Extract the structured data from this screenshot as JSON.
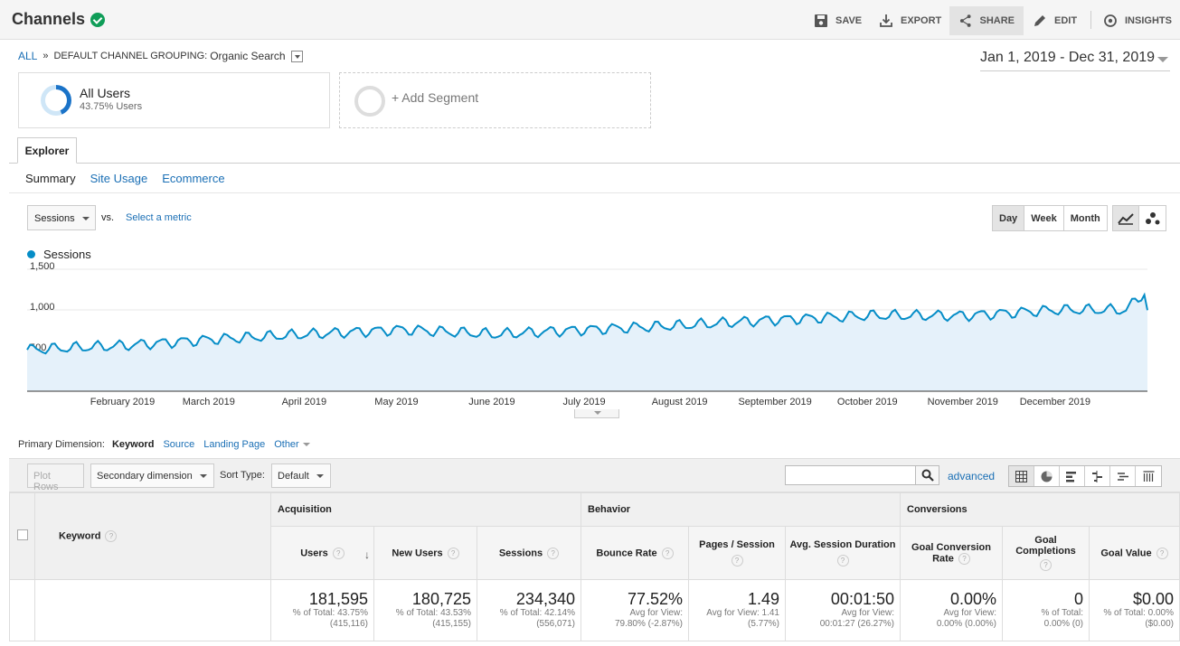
{
  "header": {
    "title": "Channels",
    "actions": [
      {
        "id": "save",
        "label": "SAVE",
        "icon": "save-icon"
      },
      {
        "id": "export",
        "label": "EXPORT",
        "icon": "export-icon"
      },
      {
        "id": "share",
        "label": "SHARE",
        "icon": "share-icon"
      },
      {
        "id": "edit",
        "label": "EDIT",
        "icon": "edit-icon"
      },
      {
        "id": "insights",
        "label": "INSIGHTS",
        "icon": "insights-icon"
      }
    ]
  },
  "breadcrumb": {
    "all": "ALL",
    "sep": "»",
    "grouping": "DEFAULT CHANNEL GROUPING:",
    "value": "Organic Search"
  },
  "date_range": "Jan 1, 2019 - Dec 31, 2019",
  "segments": {
    "primary_name": "All Users",
    "primary_sub": "43.75% Users",
    "add_label": "+ Add Segment"
  },
  "explorer": {
    "tab": "Explorer",
    "subtabs": [
      "Summary",
      "Site Usage",
      "Ecommerce"
    ]
  },
  "chart_controls": {
    "metric": "Sessions",
    "vs": "vs.",
    "select_metric": "Select a metric",
    "periods": [
      "Day",
      "Week",
      "Month"
    ],
    "selected_period": "Day"
  },
  "chart_data": {
    "type": "area",
    "legend": [
      "Sessions"
    ],
    "series": [
      {
        "name": "Sessions",
        "color": "#058dc7"
      }
    ],
    "y_ticks": [
      "1,500",
      "1,000",
      "500"
    ],
    "ylim": [
      0,
      1500
    ],
    "x_ticks": [
      "February 2019",
      "March 2019",
      "April 2019",
      "May 2019",
      "June 2019",
      "July 2019",
      "August 2019",
      "September 2019",
      "October 2019",
      "November 2019",
      "December 2019"
    ],
    "monthly_mean": [
      510,
      560,
      640,
      700,
      760,
      700,
      760,
      810,
      880,
      930,
      930,
      1000
    ],
    "weekly_amplitude": 55,
    "days": 365
  },
  "primary_dimension": {
    "label": "Primary Dimension:",
    "selected": "Keyword",
    "options": [
      "Source",
      "Landing Page"
    ],
    "other": "Other"
  },
  "table_toolbar": {
    "plot_rows": "Plot Rows",
    "secondary": "Secondary dimension",
    "sort_type_label": "Sort Type:",
    "sort_type": "Default",
    "search_value": "",
    "advanced": "advanced"
  },
  "table": {
    "keyword_header": "Keyword",
    "groups": [
      "Acquisition",
      "Behavior",
      "Conversions"
    ],
    "columns": [
      "Users",
      "New Users",
      "Sessions",
      "Bounce Rate",
      "Pages / Session",
      "Avg. Session Duration",
      "Goal Conversion Rate",
      "Goal Completions",
      "Goal Value"
    ],
    "totals": [
      {
        "value": "181,595",
        "sub1": "% of Total: 43.75%",
        "sub2": "(415,116)"
      },
      {
        "value": "180,725",
        "sub1": "% of Total: 43.53%",
        "sub2": "(415,155)"
      },
      {
        "value": "234,340",
        "sub1": "% of Total: 42.14%",
        "sub2": "(556,071)"
      },
      {
        "value": "77.52%",
        "sub1": "Avg for View:",
        "sub2": "79.80% (-2.87%)"
      },
      {
        "value": "1.49",
        "sub1": "Avg for View: 1.41",
        "sub2": "(5.77%)"
      },
      {
        "value": "00:01:50",
        "sub1": "Avg for View:",
        "sub2": "00:01:27 (26.27%)"
      },
      {
        "value": "0.00%",
        "sub1": "Avg for View:",
        "sub2": "0.00% (0.00%)"
      },
      {
        "value": "0",
        "sub1": "% of Total:",
        "sub2": "0.00% (0)"
      },
      {
        "value": "$0.00",
        "sub1": "% of Total: 0.00%",
        "sub2": "($0.00)"
      }
    ]
  }
}
